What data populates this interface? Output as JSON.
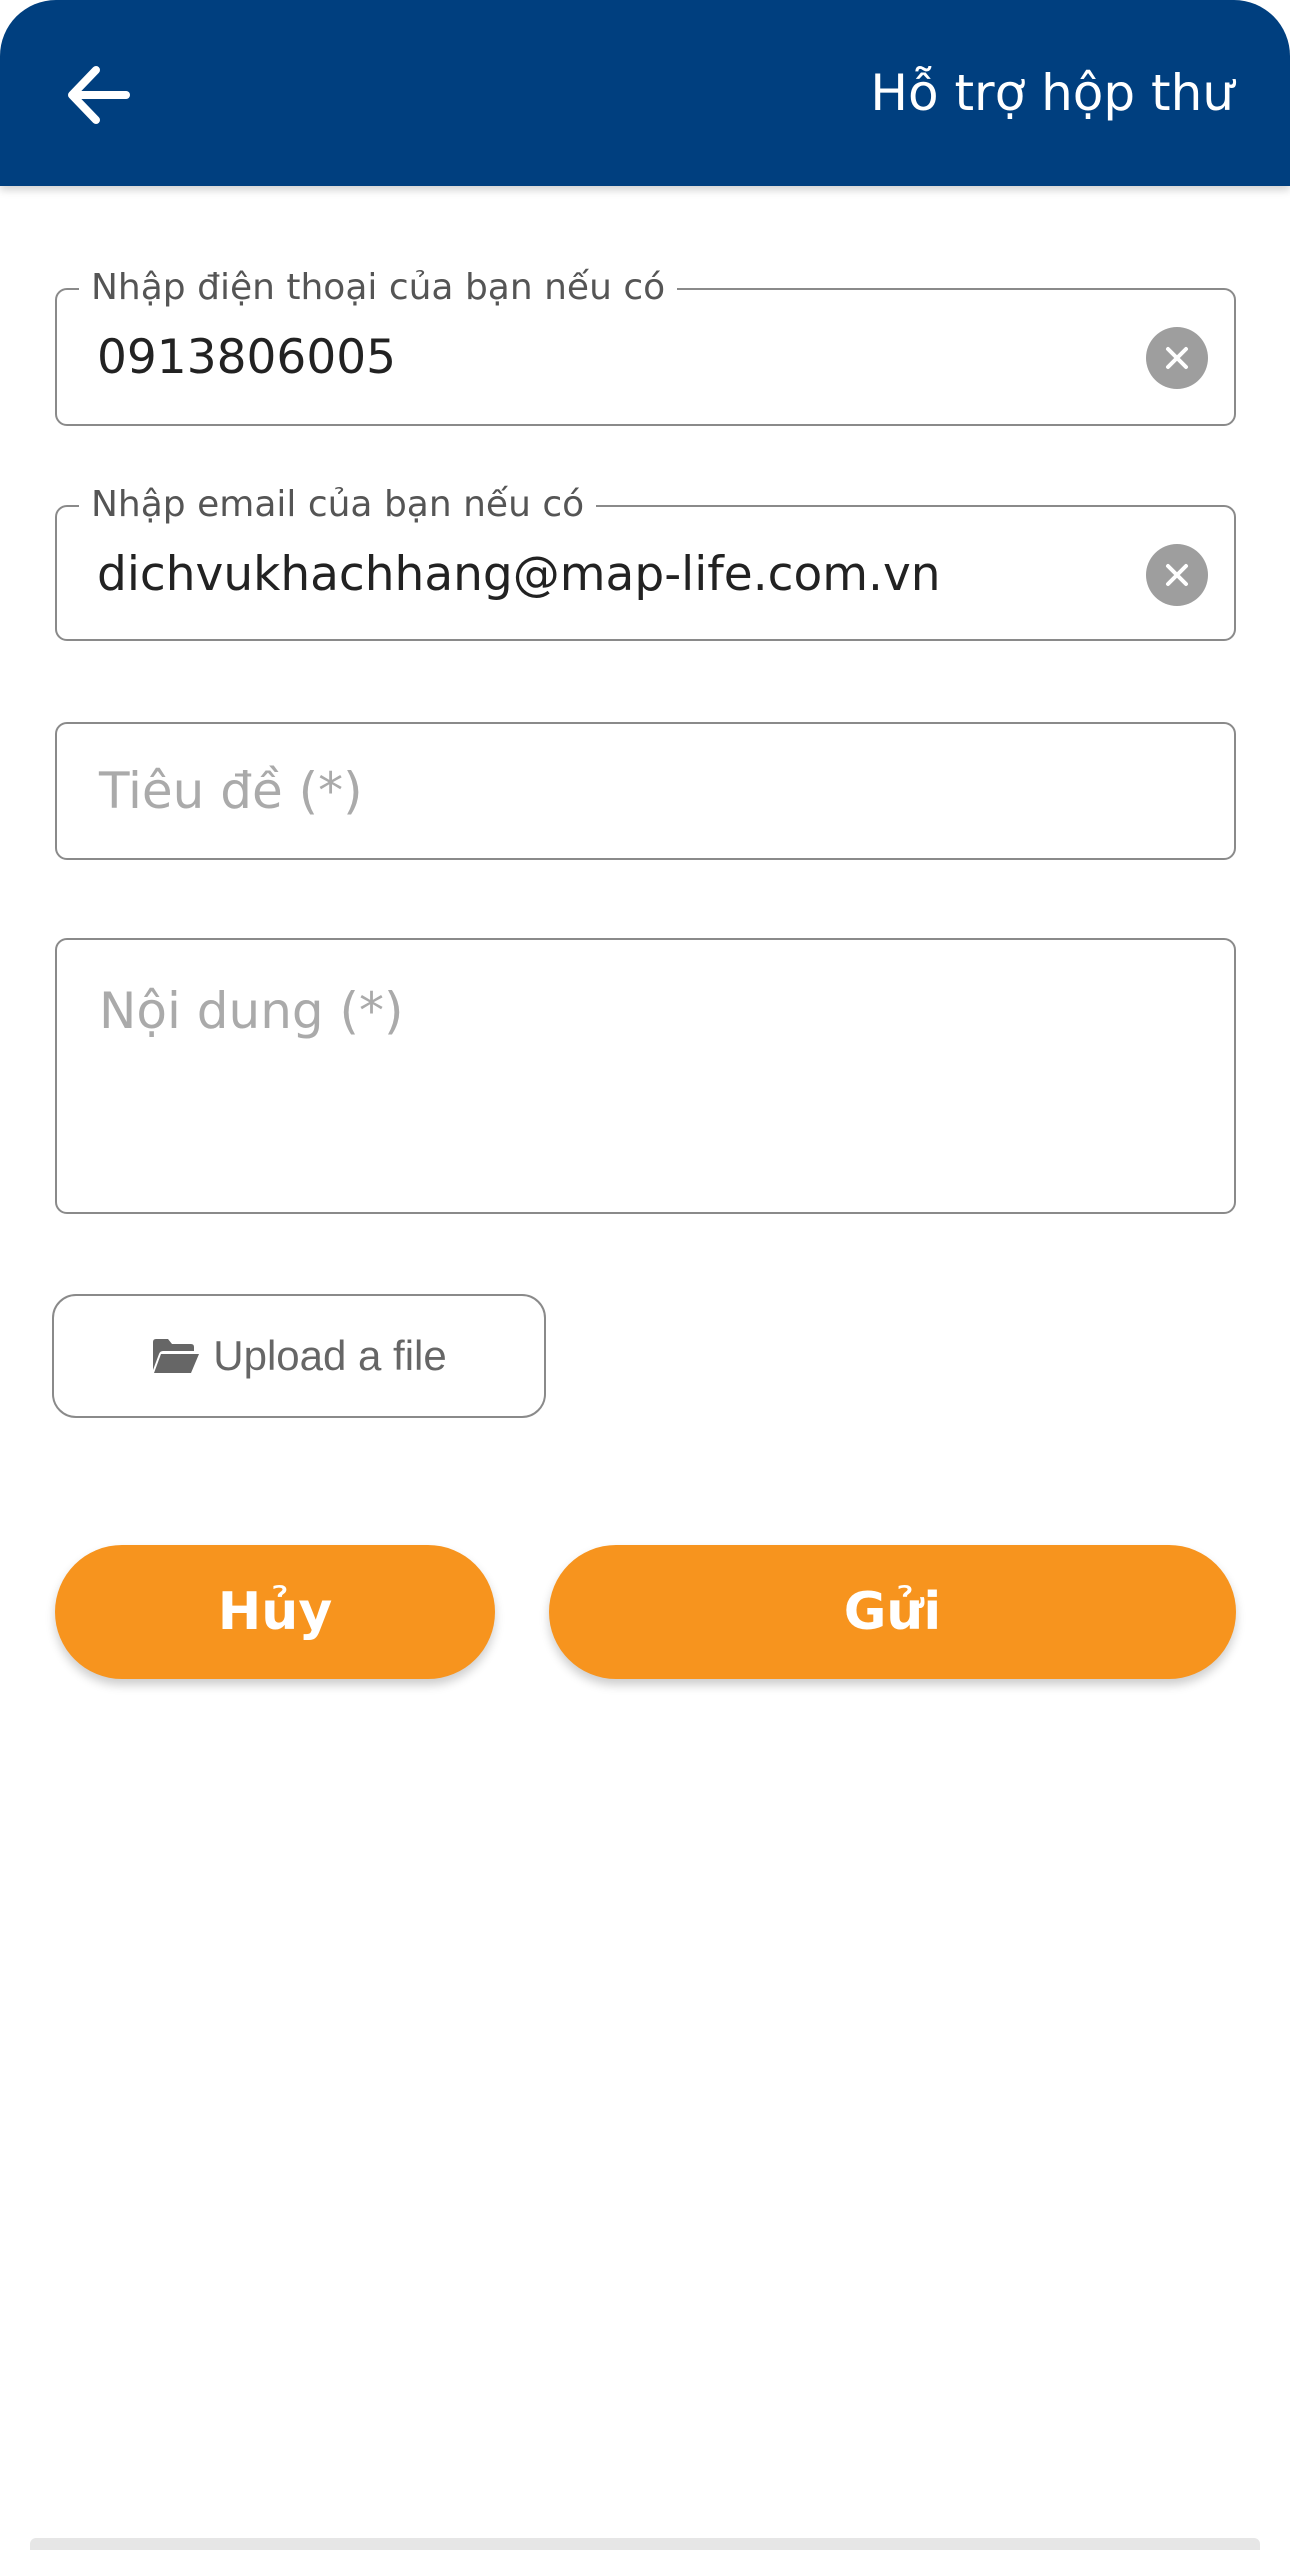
{
  "header": {
    "title": "Hỗ trợ hộp thư",
    "back_icon": "arrow-left-icon"
  },
  "form": {
    "phone": {
      "label": "Nhập điện thoại của bạn nếu có",
      "value": "0913806005",
      "clear_icon": "close-circle-icon"
    },
    "email": {
      "label": "Nhập email của bạn nếu có",
      "value": "dichvukhachhang@map-life.com.vn",
      "clear_icon": "close-circle-icon"
    },
    "subject": {
      "placeholder": "Tiêu đề (*)"
    },
    "content": {
      "placeholder": "Nội dung (*)"
    },
    "upload": {
      "label": "Upload a file",
      "icon": "folder-open-icon"
    }
  },
  "actions": {
    "cancel_label": "Hủy",
    "send_label": "Gửi"
  },
  "colors": {
    "header_bg": "#003f7f",
    "accent": "#f7941e",
    "border": "#8a8a8a",
    "placeholder": "#aaaaaa"
  }
}
